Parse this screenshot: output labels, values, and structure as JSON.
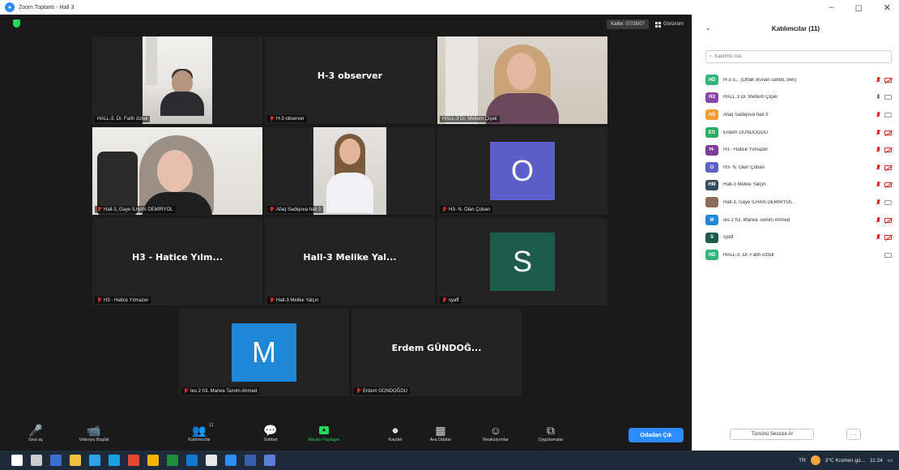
{
  "window": {
    "title": "Zoom Toplantı - Hall 3",
    "controls": [
      "–",
      "◻",
      "✕"
    ]
  },
  "meeting": {
    "view_badge": "Kalite: 07/28/07",
    "gallery_label": "Görünüm",
    "tiles": [
      {
        "label": "HALL-3, Dr. Fatih özbul",
        "big": "",
        "muted": false,
        "kind": "man"
      },
      {
        "label": "H-3 observer",
        "big": "H-3 observer",
        "muted": true,
        "kind": "none"
      },
      {
        "label": "HALL-3 Dr. Meltem Çiçek",
        "big": "",
        "muted": false,
        "kind": "woman1"
      },
      {
        "label": "Hall-3, Gaye İLHAN DEMİRYOL",
        "big": "",
        "muted": true,
        "kind": "woman2",
        "active": true
      },
      {
        "label": "Afaq Sadiqova hall 3",
        "big": "",
        "muted": true,
        "kind": "woman3"
      },
      {
        "label": "H3- N. Olan Çoban",
        "big": "",
        "muted": true,
        "kind": "avatar",
        "avatar_letter": "O",
        "avatar_color": "#5b5fc7"
      },
      {
        "label": "H3 - Hatice Yılmazer",
        "big": "H3 - Hatice Yılm...",
        "muted": true,
        "kind": "none"
      },
      {
        "label": "Hall-3 Melike Yalçın",
        "big": "Hall-3 Melike Yal...",
        "muted": true,
        "kind": "none"
      },
      {
        "label": "syaff",
        "big": "",
        "muted": true,
        "kind": "avatar",
        "avatar_letter": "S",
        "avatar_color": "#1d5c4a"
      },
      {
        "label": "Ies 2 h3. Marwa Tamim Ahmed",
        "big": "",
        "muted": true,
        "kind": "avatar",
        "avatar_letter": "M",
        "avatar_color": "#1e88d6"
      },
      {
        "label": "Erdem GÜNDOĞDU",
        "big": "Erdem GÜNDOĞ...",
        "muted": true,
        "kind": "none"
      }
    ]
  },
  "toolbar": {
    "buttons": [
      {
        "label": "Sesi aç",
        "icon": "🎤"
      },
      {
        "label": "Videoyu Başlat",
        "icon": "📹"
      },
      {
        "label": "Katılımcılar",
        "icon": "👥",
        "count": "11"
      },
      {
        "label": "Sohbet",
        "icon": "💬"
      },
      {
        "label": "Ekranı Paylaşın",
        "icon": "share"
      },
      {
        "label": "Kaydet",
        "icon": "⏺"
      },
      {
        "label": "Ara Odalar",
        "icon": "▦"
      },
      {
        "label": "Reaksiyonlar",
        "icon": "☺"
      },
      {
        "label": "Uygulamalar",
        "icon": "⧉"
      }
    ],
    "leave_label": "Odadan Çık"
  },
  "panel": {
    "title": "Katılımcılar (11)",
    "search_placeholder": "Katılımcı bul",
    "participants": [
      {
        "initials": "HD",
        "color": "#2fb57a",
        "name": "H-3 o... (Ortak olunan sahibi, ben)",
        "mic": "off",
        "cam": "off"
      },
      {
        "initials": "H3",
        "color": "#8e44ad",
        "name": "HALL 3 Dr. Meltem Çiçek",
        "mic": "on",
        "cam": "on"
      },
      {
        "initials": "AS",
        "color": "#f39c34",
        "name": "Afaq Sadiqova hall 3",
        "mic": "off",
        "cam": "on"
      },
      {
        "initials": "EG",
        "color": "#27ae60",
        "name": "Erdem GÜNDOĞDU",
        "mic": "off",
        "cam": "off"
      },
      {
        "initials": "H-",
        "color": "#7d3c98",
        "name": "H3 - Hatice Yılmazer",
        "mic": "off",
        "cam": "off"
      },
      {
        "initials": "O",
        "color": "#5b5fc7",
        "name": "H3- N. Olan Çoban",
        "mic": "off",
        "cam": "off"
      },
      {
        "initials": "HM",
        "color": "#34495e",
        "name": "Hall-3 Melike Yalçın",
        "mic": "off",
        "cam": "off"
      },
      {
        "initials": "",
        "color": "#8a6d5a",
        "name": "Hall-3, Gaye İLHAN DEMİRYOL",
        "mic": "off",
        "cam": "on"
      },
      {
        "initials": "M",
        "color": "#1e88d6",
        "name": "Ies 2 h3. Marwa Tamim Ahmed",
        "mic": "off",
        "cam": "off"
      },
      {
        "initials": "S",
        "color": "#1d5c4a",
        "name": "syaff",
        "mic": "off",
        "cam": "off"
      },
      {
        "initials": "HD",
        "color": "#2fb57a",
        "name": "HALL-3, Dr. Fatih özbul",
        "mic": "none",
        "cam": "on"
      }
    ],
    "mute_all_label": "Tümünü Sessize Al",
    "more_label": "···"
  },
  "taskbar": {
    "weather": "3°C Kısmen gü...",
    "clock": "11:24",
    "lang": "TR",
    "app_colors": [
      "#ffffff",
      "#cccccc",
      "#3b6fd1",
      "#f0c040",
      "#2fa3e6",
      "#1aa1e1",
      "#e34b2e",
      "#f4b400",
      "#1e8e3e",
      "#0f7ad6",
      "#e8e8e8",
      "#2d8cff",
      "#3b5fb0",
      "#5b7fd8"
    ]
  }
}
